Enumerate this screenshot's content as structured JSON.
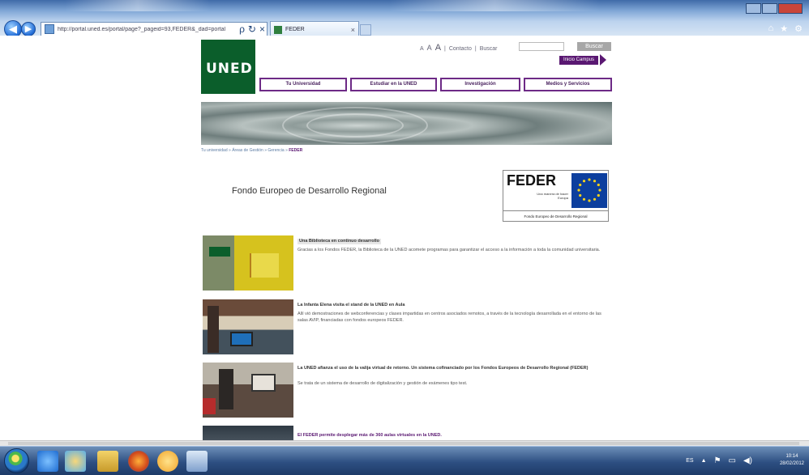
{
  "browser": {
    "url": "http://portal.uned.es/portal/page?_pageid=93,FEDER&_dad=portal",
    "search_glyph": "ρ",
    "stop_glyph": "×",
    "refresh_glyph": "↻",
    "tab_label": "FEDER",
    "tab_close": "×",
    "back": "◀",
    "forward": "▶",
    "right_icons": [
      "⌂",
      "★",
      "⚙"
    ]
  },
  "header": {
    "logo": "UNED",
    "font_small": "A",
    "font_mid": "A",
    "font_big": "A",
    "contact": "Contacto",
    "search_label": "Buscar",
    "search_button": "Buscar",
    "campus_button": "Inicio Campus",
    "nav": [
      "Tu Universidad",
      "Estudiar en la UNED",
      "Investigación",
      "Medios y Servicios"
    ]
  },
  "breadcrumb": {
    "items": [
      "Tu universidad",
      "Áreas de Gestión",
      "Gerencia"
    ],
    "current": "FEDER"
  },
  "main": {
    "heading": "Fondo Europeo de Desarrollo Regional",
    "feder_logo": {
      "word": "FEDER",
      "tagline": "Una manera de hacer Europa",
      "caption": "Fondo Europeo de Desarrollo Regional",
      "flag_label": "Unión Europea"
    }
  },
  "news": [
    {
      "title": "Una Biblioteca en continuo desarrollo",
      "body": "Gracias a los Fondos FEDER, la Biblioteca de la UNED acomete programas para garantizar el acceso a la información a toda la comunidad universitaria."
    },
    {
      "title": "La Infanta Elena visita el stand de la UNED en Aula",
      "body": "Allí vió demostraciones de webconferencias y clases impartidas en centros asociados remotos, a través de la tecnología desarrollada en el entorno de las salas AVIP, financiadas con fondos europeos FEDER."
    },
    {
      "title": "La UNED afianza el uso de la valija virtual de retorno. Un sistema cofinanciado por los Fondos Europeos de Desarrollo Regional (FEDER)",
      "body": "Se trata de un sistema de desarrollo de digitalización y gestión de exámenes tipo test."
    },
    {
      "title": "El FEDER permite desplegar más de 360 aulas virtuales en la UNED.",
      "body": ""
    }
  ],
  "taskbar": {
    "time": "10:14",
    "date": "28/02/2012",
    "tray": [
      "ES",
      "▲",
      "⚑",
      "▭",
      "◀)"
    ]
  },
  "colors": {
    "uned_green": "#0b5e2b",
    "uned_purple": "#5a1872",
    "taskbar": "#2d4f82"
  }
}
